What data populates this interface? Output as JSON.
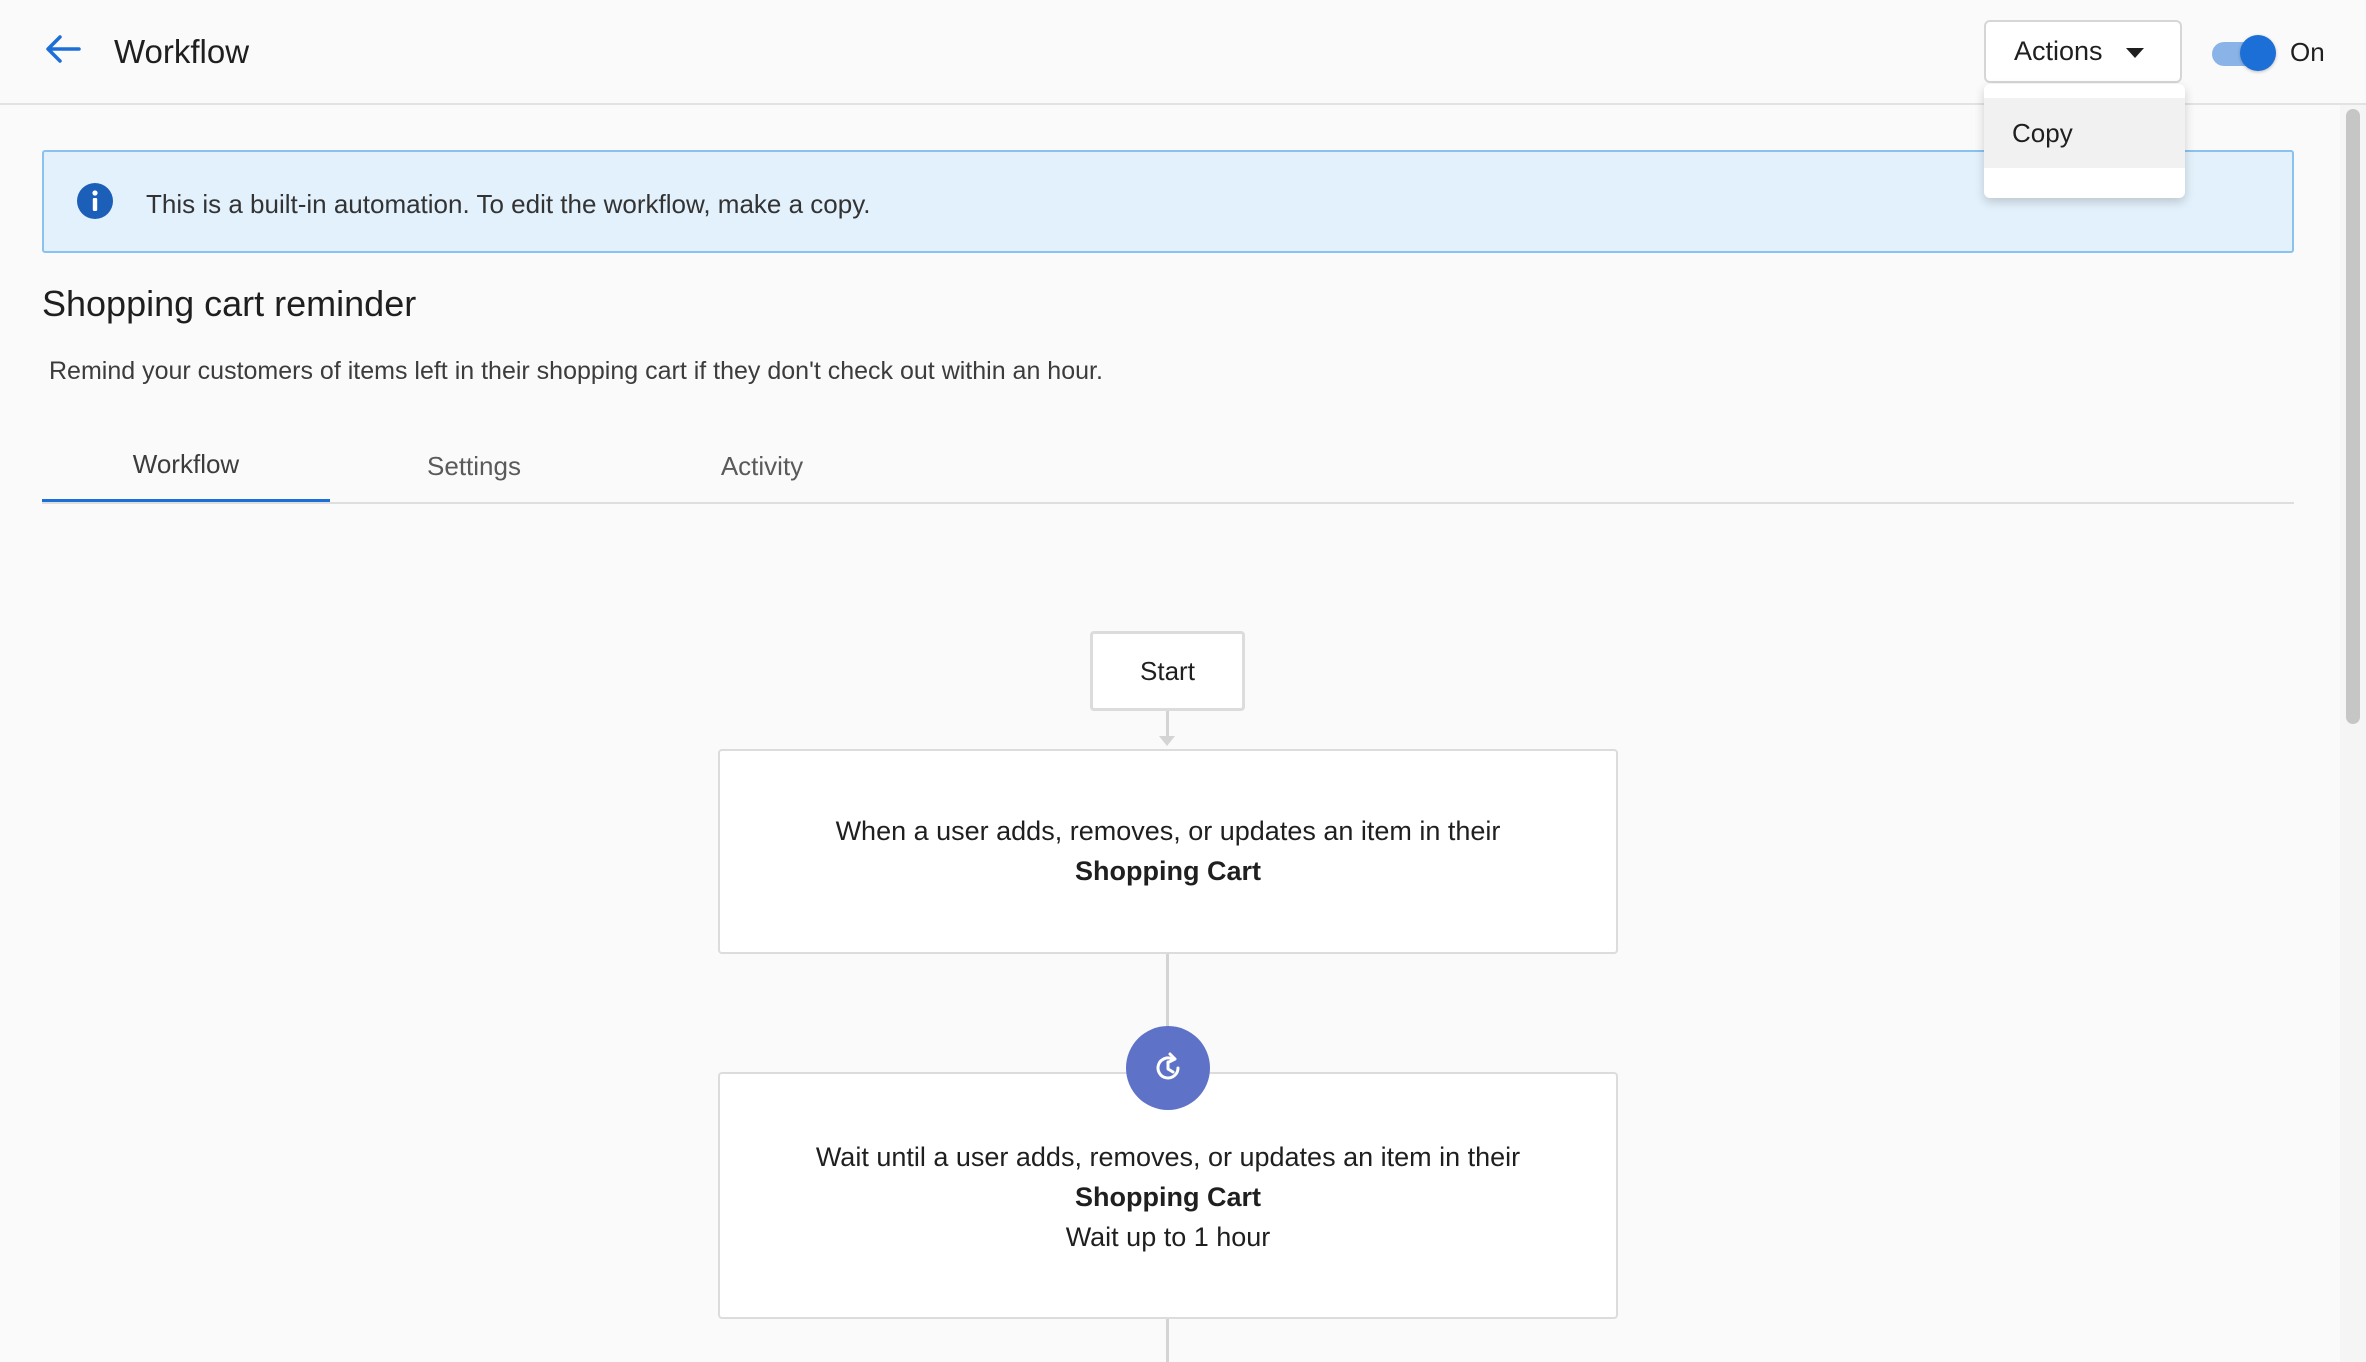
{
  "header": {
    "title": "Workflow",
    "actions_label": "Actions",
    "toggle_label": "On",
    "toggle_on": true
  },
  "actions_menu": {
    "items": [
      {
        "label": "Copy"
      }
    ]
  },
  "banner": {
    "text": "This is a built-in automation. To edit the workflow, make a copy.",
    "icon": "info-icon"
  },
  "workflow": {
    "name": "Shopping cart reminder",
    "description": "Remind your customers of items left in their shopping cart if they don't check out within an hour."
  },
  "tabs": [
    {
      "label": "Workflow",
      "active": true
    },
    {
      "label": "Settings",
      "active": false
    },
    {
      "label": "Activity",
      "active": false
    }
  ],
  "diagram": {
    "start_label": "Start",
    "trigger": {
      "text": "When a user adds, removes, or updates an item in their",
      "object": "Shopping Cart"
    },
    "wait": {
      "icon": "timer-reset-icon",
      "text": "Wait until a user adds, removes, or updates an item in their",
      "object": "Shopping Cart",
      "duration": "Wait up to 1 hour"
    }
  },
  "colors": {
    "accent": "#1c6fd6",
    "banner_bg": "#e3f1fc",
    "banner_border": "#89c2ee",
    "wait_icon_bg": "#5e72c7"
  }
}
